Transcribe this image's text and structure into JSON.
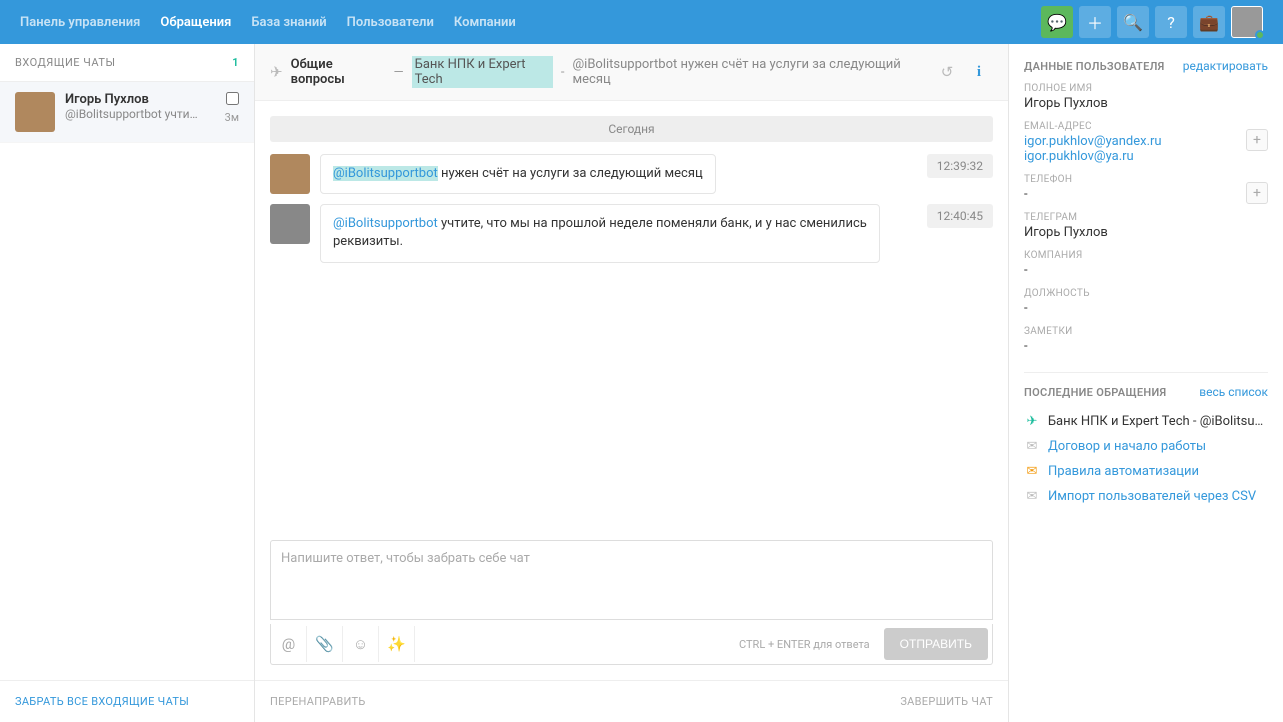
{
  "nav": {
    "items": [
      "Панель управления",
      "Обращения",
      "База знаний",
      "Пользователи",
      "Компании"
    ],
    "activeIndex": 1
  },
  "sidebar": {
    "title": "ВХОДЯЩИЕ ЧАТЫ",
    "count": "1",
    "chat": {
      "name": "Игорь Пухлов",
      "snippet": "@iBolitsupportbot учти…",
      "time": "3м"
    },
    "footer": "ЗАБРАТЬ ВСЕ ВХОДЯЩИЕ ЧАТЫ"
  },
  "header": {
    "category": "Общие вопросы",
    "dash": "—",
    "company": "Банк НПК и Expert Tech",
    "sep": "-",
    "subject": "@iBolitsupportbot нужен счёт на услуги за следующий месяц"
  },
  "chat": {
    "dateLabel": "Сегодня",
    "messages": [
      {
        "mention": "@iBolitsupportbot",
        "text": " нужен счёт на услуги за следующий месяц",
        "time": "12:39:32"
      },
      {
        "mention": "@iBolitsupportbot",
        "text": " учтите, что мы на прошлой неделе поменяли банк, и у нас сменились реквизиты.",
        "time": "12:40:45"
      }
    ]
  },
  "compose": {
    "placeholder": "Напишите ответ, чтобы забрать себе чат",
    "hint": "CTRL + ENTER для ответа",
    "send": "ОТПРАВИТЬ"
  },
  "footer": {
    "left": "ПЕРЕНАПРАВИТЬ",
    "right": "ЗАВЕРШИТЬ ЧАТ"
  },
  "user": {
    "title": "ДАННЫЕ ПОЛЬЗОВАТЕЛЯ",
    "editLabel": "редактировать",
    "fields": {
      "fullNameLabel": "ПОЛНОЕ ИМЯ",
      "fullName": "Игорь Пухлов",
      "emailLabel": "EMAIL-АДРЕС",
      "emails": [
        "igor.pukhlov@yandex.ru",
        "igor.pukhlov@ya.ru"
      ],
      "phoneLabel": "ТЕЛЕФОН",
      "phone": "-",
      "telegramLabel": "ТЕЛЕГРАМ",
      "telegram": "Игорь Пухлов",
      "companyLabel": "КОМПАНИЯ",
      "company": "-",
      "positionLabel": "ДОЛЖНОСТЬ",
      "position": "-",
      "notesLabel": "ЗАМЕТКИ",
      "notes": "-"
    }
  },
  "recent": {
    "title": "ПОСЛЕДНИЕ ОБРАЩЕНИЯ",
    "allLabel": "весь список",
    "items": [
      {
        "icon": "send",
        "iconClass": "green",
        "text": "Банк НПК и Expert Tech - @iBolitsup…",
        "current": true
      },
      {
        "icon": "mail",
        "iconClass": "",
        "text": "Договор и начало работы"
      },
      {
        "icon": "mail",
        "iconClass": "orange",
        "text": "Правила автоматизации"
      },
      {
        "icon": "mail",
        "iconClass": "",
        "text": "Импорт пользователей через CSV"
      }
    ]
  }
}
